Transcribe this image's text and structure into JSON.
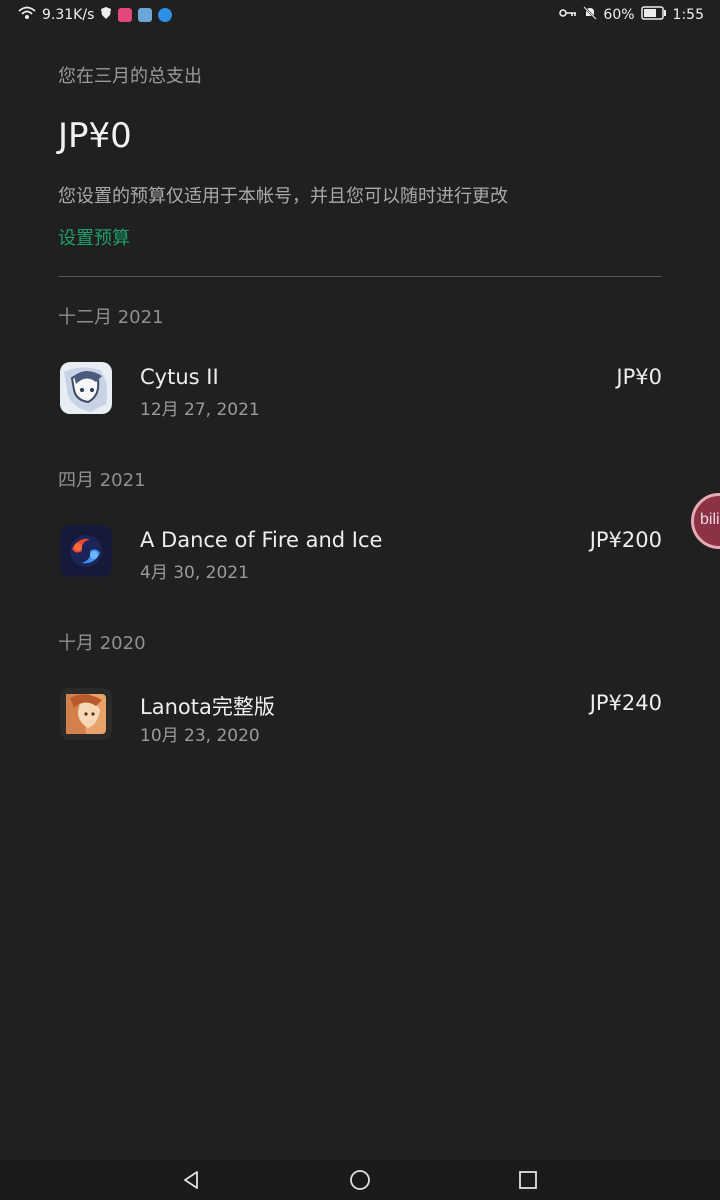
{
  "status_bar": {
    "net_speed": "9.31K/s",
    "battery": "60%",
    "time": "1:55",
    "icons": [
      "wifi-icon",
      "shield-icon",
      "app-icon-pink",
      "app-icon-image",
      "app-icon-blue",
      "key-icon",
      "bell-muted-icon",
      "battery-icon"
    ]
  },
  "summary": {
    "month_label": "您在三月的总支出",
    "amount": "JP¥0",
    "description": "您设置的预算仅适用于本帐号，并且您可以随时进行更改",
    "set_budget_link": "设置预算"
  },
  "sections": [
    {
      "title": "十二月 2021",
      "items": [
        {
          "title": "Cytus II",
          "date": "12月 27, 2021",
          "price": "JP¥0",
          "icon": "cytus-icon"
        }
      ]
    },
    {
      "title": "四月 2021",
      "items": [
        {
          "title": "A Dance of Fire and Ice",
          "date": "4月 30, 2021",
          "price": "JP¥200",
          "icon": "adofai-icon"
        }
      ]
    },
    {
      "title": "十月 2020",
      "items": [
        {
          "title": "Lanota完整版",
          "date": "10月 23, 2020",
          "price": "JP¥240",
          "icon": "lanota-icon"
        }
      ]
    }
  ],
  "floating_badge": {
    "text": "bili"
  },
  "colors": {
    "background": "#202020",
    "accent_link": "#1e9f6a",
    "secondary_text": "#9a9a9a"
  }
}
